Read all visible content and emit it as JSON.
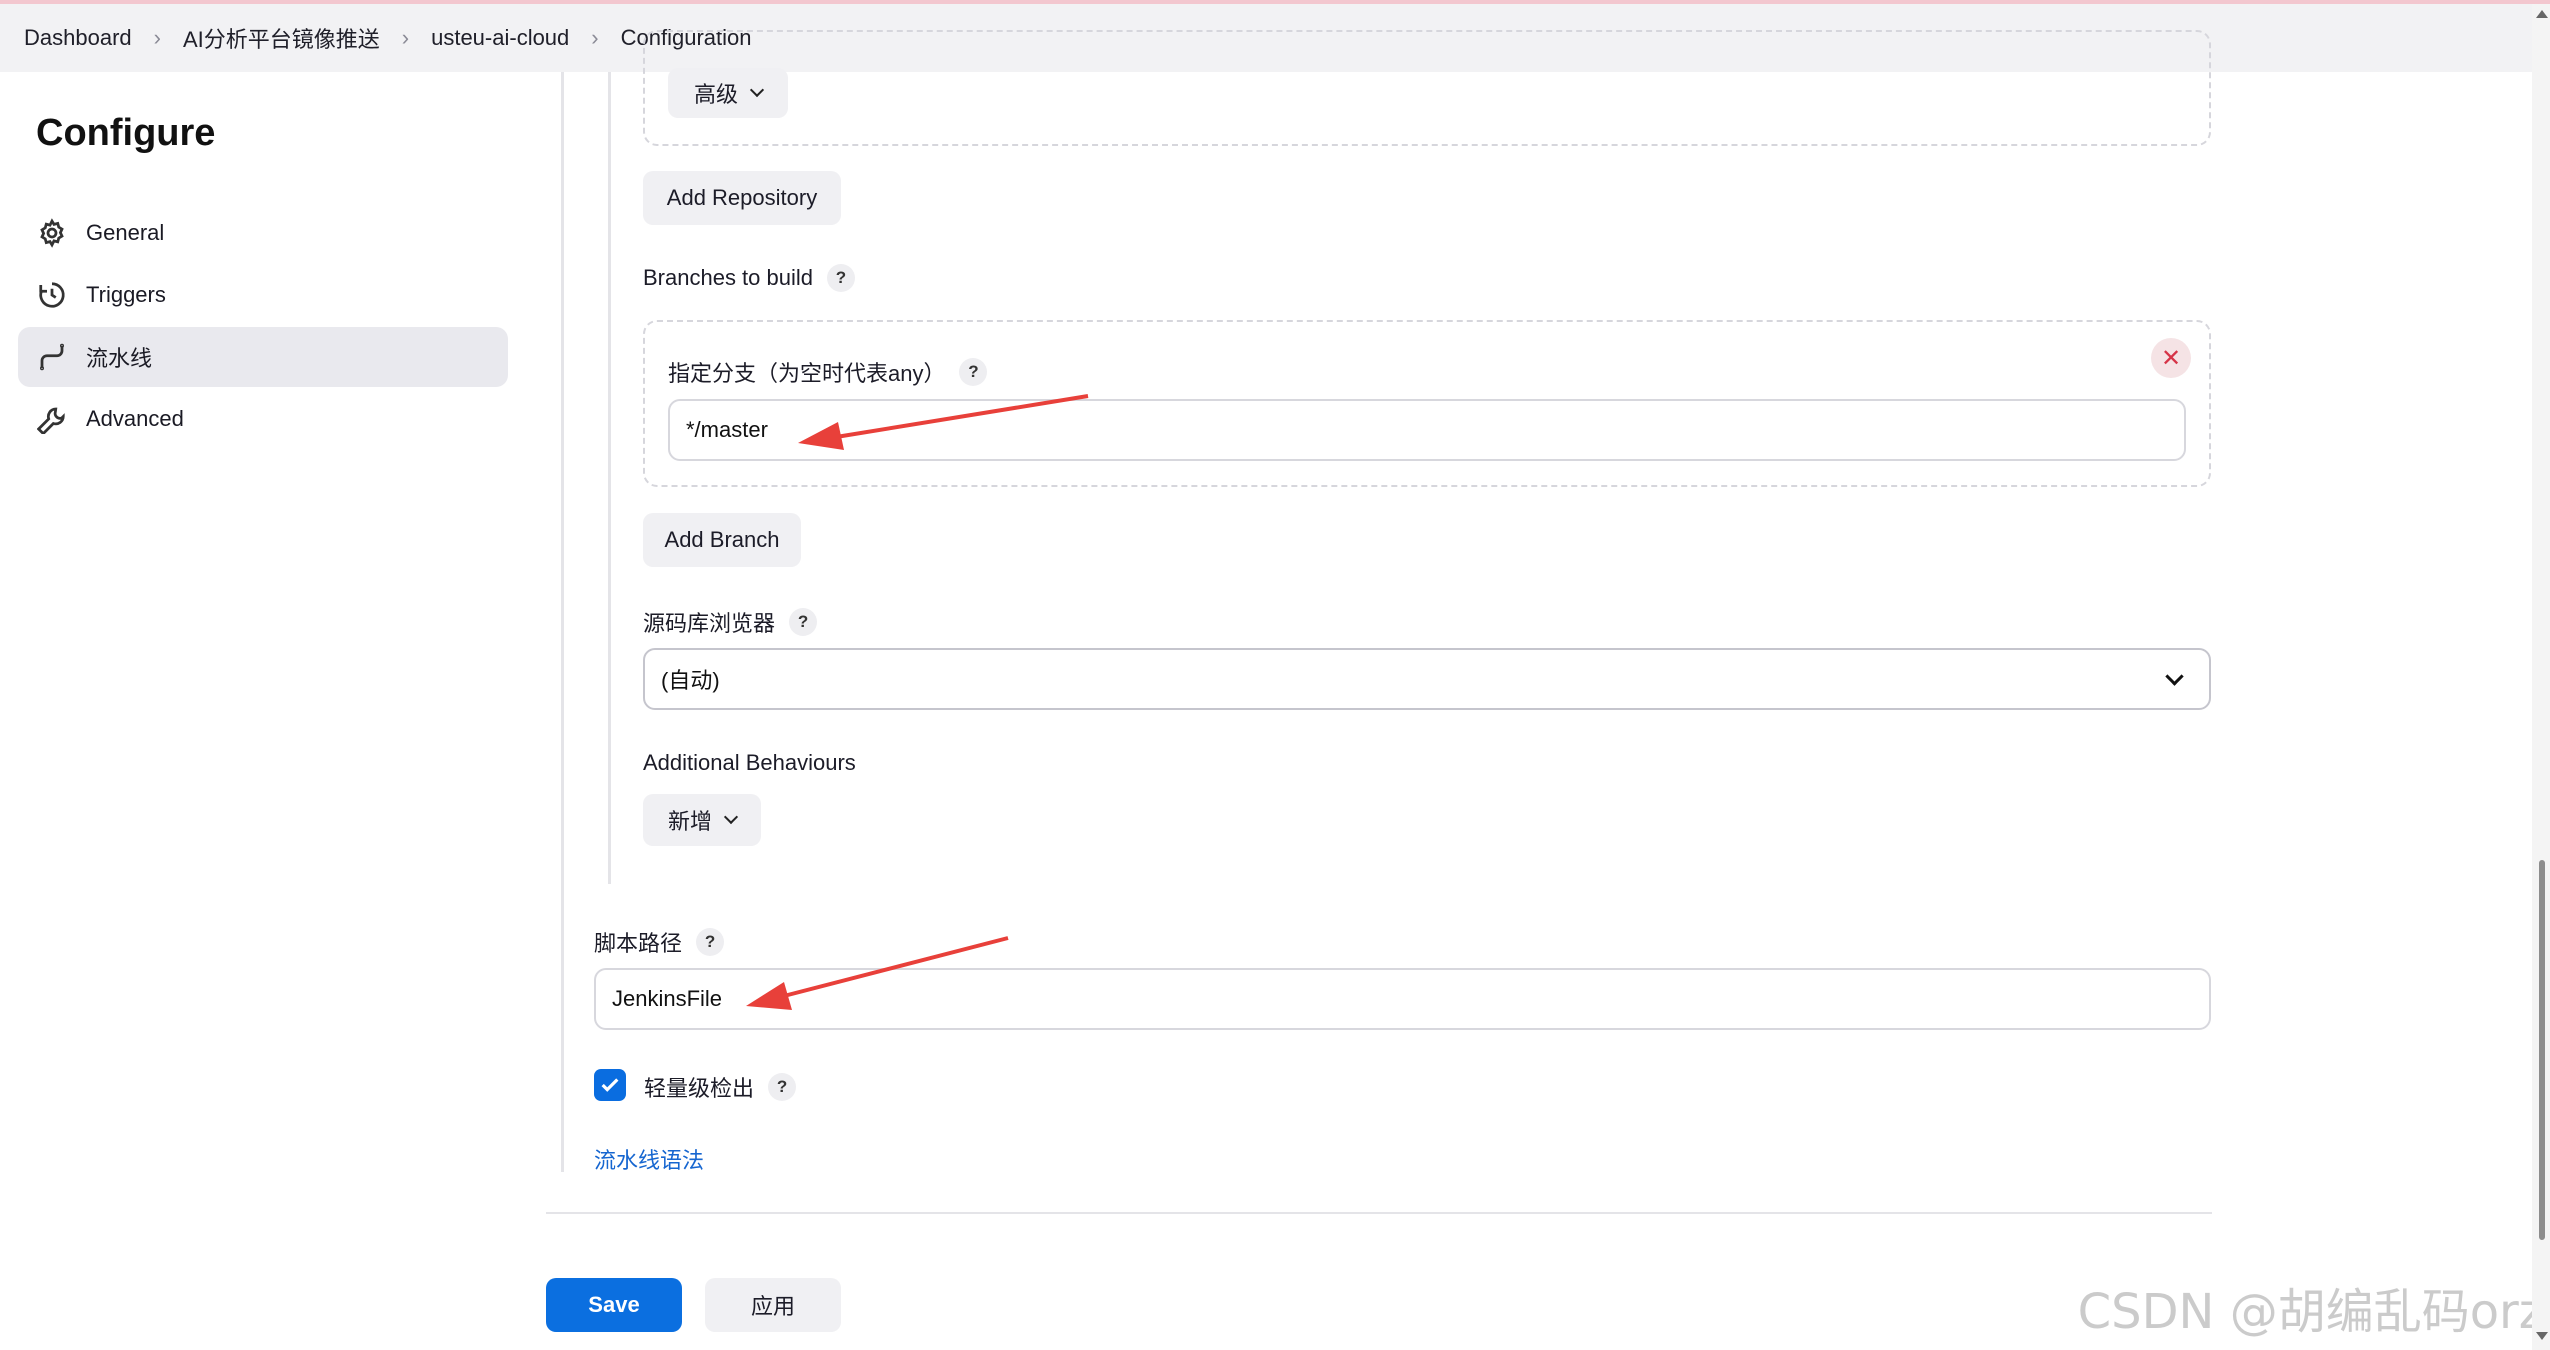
{
  "breadcrumb": [
    {
      "label": "Dashboard"
    },
    {
      "label": "AI分析平台镜像推送"
    },
    {
      "label": "usteu-ai-cloud"
    },
    {
      "label": "Configuration"
    }
  ],
  "sidebar": {
    "title": "Configure",
    "items": [
      {
        "label": "General",
        "icon": "gear-icon",
        "active": false
      },
      {
        "label": "Triggers",
        "icon": "clock-icon",
        "active": false
      },
      {
        "label": "流水线",
        "icon": "pipeline-icon",
        "active": true
      },
      {
        "label": "Advanced",
        "icon": "wrench-icon",
        "active": false
      }
    ]
  },
  "scm": {
    "advanced_label": "高级",
    "add_repository_label": "Add Repository",
    "branches_label": "Branches to build",
    "branch_specifier_label": "指定分支（为空时代表any）",
    "branch_specifier_value": "*/master",
    "add_branch_label": "Add Branch",
    "repo_browser_label": "源码库浏览器",
    "repo_browser_value": "(自动)",
    "additional_behaviours_label": "Additional Behaviours",
    "add_behaviour_label": "新增"
  },
  "script": {
    "path_label": "脚本路径",
    "path_value": "JenkinsFile",
    "lightweight_label": "轻量级检出",
    "lightweight_checked": true,
    "syntax_link": "流水线语法"
  },
  "footer": {
    "save_label": "Save",
    "apply_label": "应用"
  },
  "watermark": "CSDN @胡编乱码orz",
  "help_glyph": "?",
  "close_glyph": "✕",
  "colors": {
    "primary": "#0b6fe0",
    "annotation_arrow": "#e8403a",
    "link": "#1666d0"
  }
}
